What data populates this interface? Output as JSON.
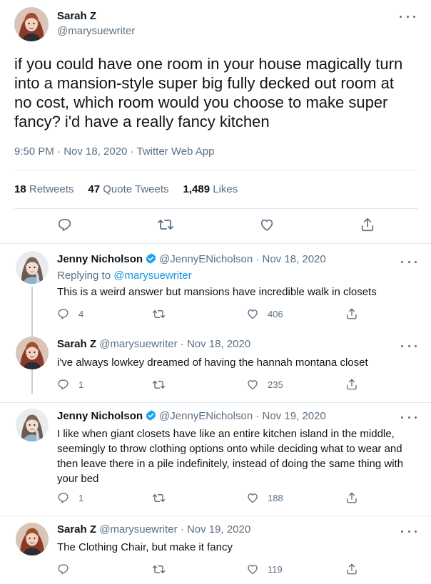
{
  "main_tweet": {
    "name": "Sarah Z",
    "handle": "@marysuewriter",
    "text": "if you could have one room in your house magically turn into a mansion-style super big fully decked out room at no cost, which room would you choose to make super fancy? i'd have a really fancy kitchen",
    "timestamp": "9:50 PM · Nov 18, 2020 · Twitter Web App",
    "stats": {
      "retweets_count": "18",
      "retweets_label": "Retweets",
      "quotes_count": "47",
      "quotes_label": "Quote Tweets",
      "likes_count": "1,489",
      "likes_label": "Likes"
    }
  },
  "replies": [
    {
      "name": "Jenny Nicholson",
      "handle": "@JennyENicholson",
      "date": "· Nov 18, 2020",
      "replying_prefix": "Replying to",
      "replying_to": "@marysuewriter",
      "text": "This is a weird answer but mansions have incredible walk in closets",
      "reply_count": "4",
      "retweet_count": "",
      "like_count": "406"
    },
    {
      "name": "Sarah Z",
      "handle": "@marysuewriter",
      "date": "· Nov 18, 2020",
      "text": "i've always lowkey dreamed of having the hannah montana closet",
      "reply_count": "1",
      "retweet_count": "",
      "like_count": "235"
    },
    {
      "name": "Jenny Nicholson",
      "handle": "@JennyENicholson",
      "date": "· Nov 19, 2020",
      "text": "I like when giant closets have like an entire kitchen island in the middle, seemingly to throw clothing options onto while deciding what to wear and then leave there in a pile indefinitely, instead of doing the same thing with your bed",
      "reply_count": "1",
      "retweet_count": "",
      "like_count": "188"
    },
    {
      "name": "Sarah Z",
      "handle": "@marysuewriter",
      "date": "· Nov 19, 2020",
      "text": "The Clothing Chair, but make it fancy",
      "reply_count": "",
      "retweet_count": "",
      "like_count": "119"
    }
  ],
  "colors": {
    "text": "#0f1419",
    "muted": "#5b7083",
    "link": "#1b95e0",
    "verified": "#1da1f2",
    "border": "#e1e8ed"
  },
  "icons": [
    "more-icon",
    "reply-icon",
    "retweet-icon",
    "like-icon",
    "share-icon",
    "verified-badge-icon"
  ]
}
